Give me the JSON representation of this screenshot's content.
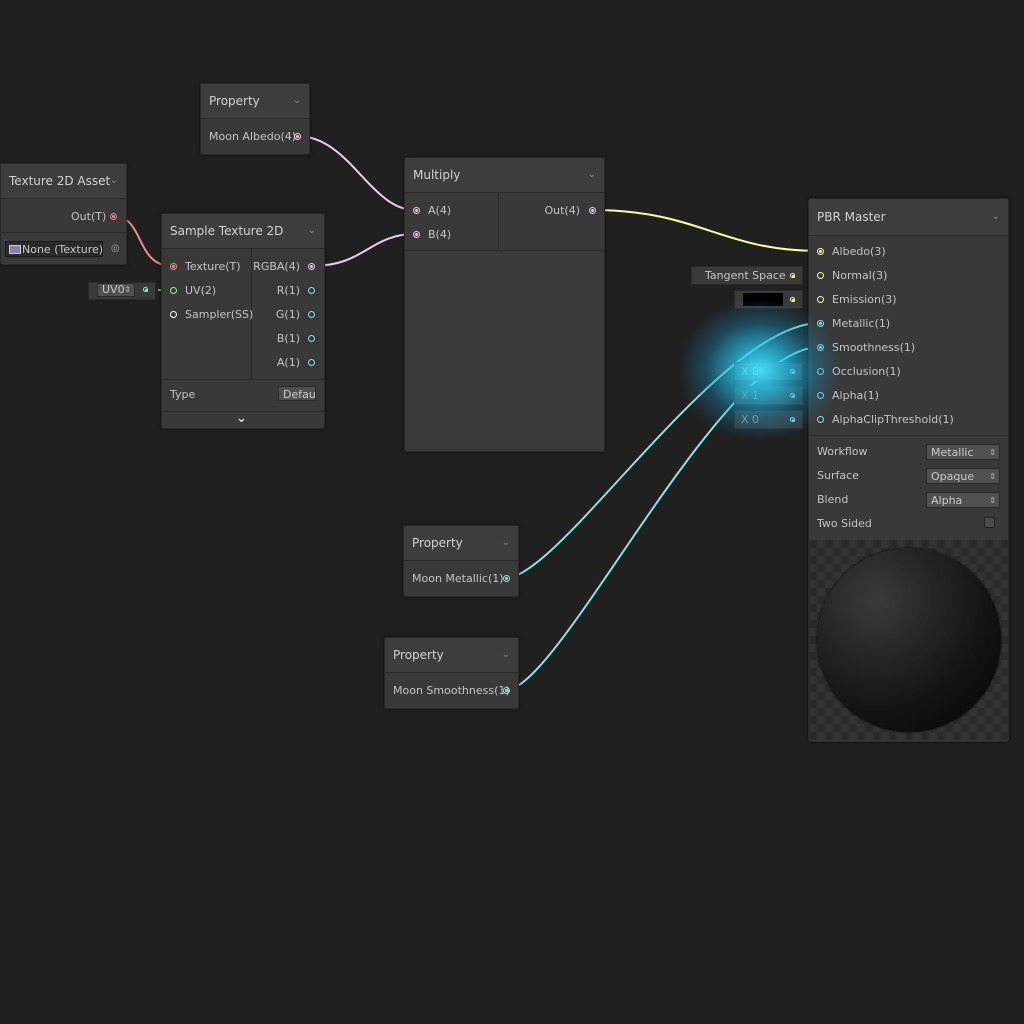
{
  "colors": {
    "background": "#202020",
    "node": "#393939",
    "texture_port": "#f08b8b",
    "vector4_port": "#f1c8ee",
    "vector3_port": "#f6ff9a",
    "vector2_port": "#9af09a",
    "vector1_port": "#84e4e7",
    "sampler_port": "#ffffff",
    "glow": "#3fe3ff"
  },
  "nodes": {
    "property_albedo": {
      "title": "Property",
      "output": "Moon Albedo(4)"
    },
    "texture_asset": {
      "title": "Texture 2D Asset",
      "output": "Out(T)",
      "field": "None (Texture)"
    },
    "sample_texture": {
      "title": "Sample Texture 2D",
      "inputs": [
        "Texture(T)",
        "UV(2)",
        "Sampler(SS)"
      ],
      "outputs": [
        "RGBA(4)",
        "R(1)",
        "G(1)",
        "B(1)",
        "A(1)"
      ],
      "type_label": "Type",
      "type_value": "Default",
      "uv_field": "UV0"
    },
    "multiply": {
      "title": "Multiply",
      "inputs": [
        "A(4)",
        "B(4)"
      ],
      "output": "Out(4)"
    },
    "pbr_master": {
      "title": "PBR Master",
      "inputs": [
        "Albedo(3)",
        "Normal(3)",
        "Emission(3)",
        "Metallic(1)",
        "Smoothness(1)",
        "Occlusion(1)",
        "Alpha(1)",
        "AlphaClipThreshold(1)"
      ],
      "tangent_space": "Tangent Space",
      "occlusion_field": "X  0",
      "alpha_field": "X  1",
      "clip_field": "X  0",
      "settings": [
        {
          "label": "Workflow",
          "value": "Metallic"
        },
        {
          "label": "Surface",
          "value": "Opaque"
        },
        {
          "label": "Blend",
          "value": "Alpha"
        }
      ],
      "two_sided": "Two Sided"
    },
    "property_metallic": {
      "title": "Property",
      "output": "Moon Metallic(1)"
    },
    "property_smoothness": {
      "title": "Property",
      "output": "Moon Smoothness(1)"
    }
  },
  "icons": {
    "chevron": "chevron-down-icon",
    "expand": "expand-chevron-icon",
    "object_picker": "object-picker-icon",
    "dropdown": "dropdown-arrows-icon"
  }
}
